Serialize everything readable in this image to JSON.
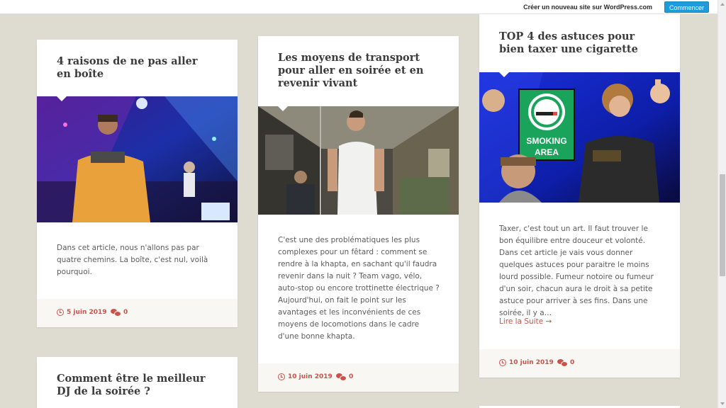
{
  "wpbar": {
    "text": "Créer un nouveau site sur WordPress.com",
    "button": "Commencer"
  },
  "posts": [
    {
      "title": "4 raisons de ne pas aller en boîte",
      "excerpt": "Dans cet article, nous n'allons pas par quatre chemins. La boîte, c'est nul, voilà pourquoi.",
      "date": "5 juin 2019",
      "comments": "0"
    },
    {
      "title": "Les moyens de transport pour aller en soirée et en revenir vivant",
      "excerpt": "C'est une des problématiques les plus complexes pour un fêtard : comment se rendre à la khapta, en sachant qu'il faudra revenir dans la nuit ? Team vago, vélo, auto-stop ou encore trottinette électrique ? Aujourd'hui, on fait le point sur les avantages et les inconvénients de ces moyens de locomotions dans le cadre d'une bonne khapta.",
      "date": "10 juin 2019",
      "comments": "0"
    },
    {
      "title": "TOP 4 des astuces pour bien taxer une cigarette",
      "excerpt": "Taxer, c'est tout un art. Il faut trouver le bon équilibre entre douceur et volonté. Dans cet article je vais vous donner quelques astuces pour paraitre le moins lourd possible. Fumeur notoire ou fumeur d'un soir, chacun aura le droit à sa petite astuce pour arriver à ses fins. Dans une soirée, il y a…",
      "readmore": "Lire la Suite →",
      "sign": "SMOKING AREA",
      "date": "10 juin 2019",
      "comments": "0"
    },
    {
      "title": "Comment être le meilleur DJ de la soirée ?"
    }
  ]
}
